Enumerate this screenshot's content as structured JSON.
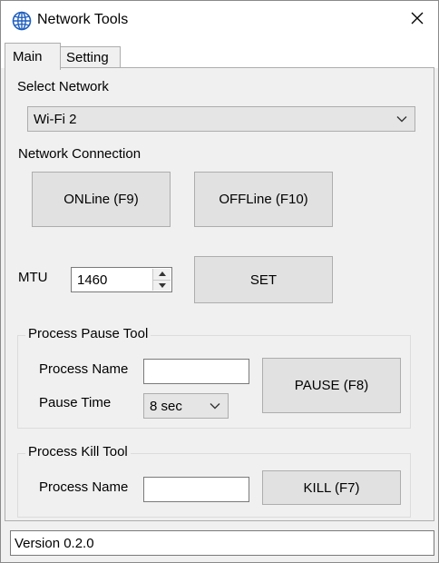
{
  "window": {
    "title": "Network Tools",
    "icons": {
      "app": "globe-network-icon",
      "close": "close-icon"
    }
  },
  "tabs": [
    {
      "label": "Main",
      "selected": true
    },
    {
      "label": "Setting",
      "selected": false
    }
  ],
  "network": {
    "select_label": "Select Network",
    "selected_value": "Wi-Fi 2"
  },
  "connection": {
    "label": "Network Connection",
    "online_label": "ONLine (F9)",
    "offline_label": "OFFLine (F10)"
  },
  "mtu": {
    "label": "MTU",
    "value": "1460",
    "set_label": "SET"
  },
  "pause_tool": {
    "title": "Process Pause Tool",
    "process_name_label": "Process Name",
    "process_name_value": "",
    "pause_time_label": "Pause Time",
    "pause_time_value": "8 sec",
    "pause_button_label": "PAUSE (F8)"
  },
  "kill_tool": {
    "title": "Process Kill Tool",
    "process_name_label": "Process Name",
    "process_name_value": "",
    "kill_button_label": "KILL (F7)"
  },
  "status": {
    "version": "Version 0.2.0"
  }
}
